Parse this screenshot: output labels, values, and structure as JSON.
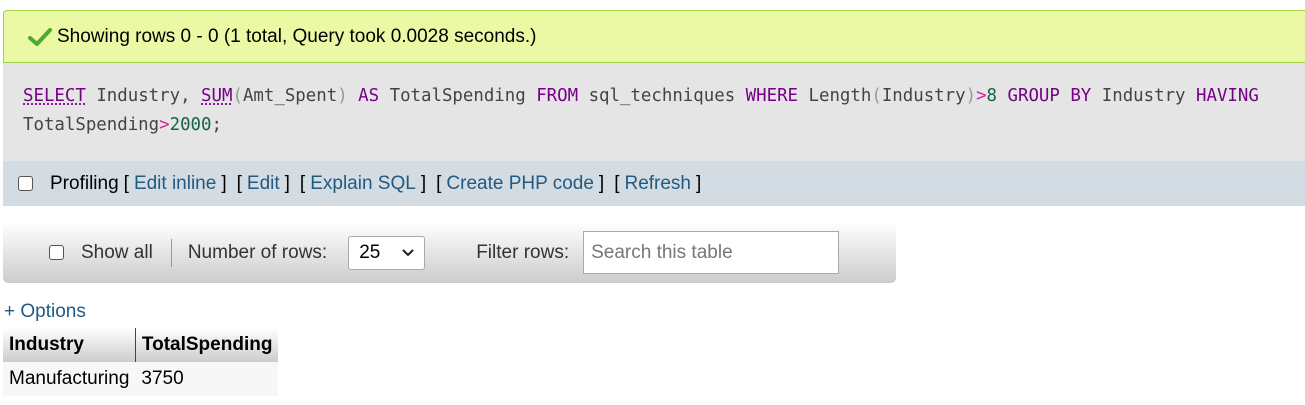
{
  "success": {
    "icon": "check-icon",
    "message": "Showing rows 0 - 0 (1 total, Query took 0.0028 seconds.)"
  },
  "sql": {
    "tokens": {
      "select": "SELECT",
      "industry": "Industry",
      "comma": ",",
      "sum": "SUM",
      "lparen": "(",
      "amt": "Amt_Spent",
      "rparen": ")",
      "as": "AS",
      "total": "TotalSpending",
      "from": "FROM",
      "table": "sql_techniques",
      "where": "WHERE",
      "length": "Length",
      "lparen2": "(",
      "industry2": "Industry",
      "rparen2": ")",
      "gt": ">",
      "eight": "8",
      "groupby": "GROUP BY",
      "industry3": "Industry",
      "having": "HAVING",
      "total2": "TotalSpending",
      "gt2": ">",
      "num2000": "2000",
      "semi": ";"
    }
  },
  "toolbar": {
    "profiling_label": "Profiling",
    "lb": "[",
    "rb": "]",
    "links": [
      "Edit inline",
      "Edit",
      "Explain SQL",
      "Create PHP code",
      "Refresh"
    ]
  },
  "nav": {
    "show_all_label": "Show all",
    "rows_label": "Number of rows:",
    "rows_value": "25",
    "filter_label": "Filter rows:",
    "search_placeholder": "Search this table"
  },
  "options_link": "+ Options",
  "table": {
    "columns": [
      "Industry",
      "TotalSpending"
    ],
    "rows": [
      [
        "Manufacturing",
        "3750"
      ]
    ]
  },
  "colors": {
    "success_bg": "#ebf8a4",
    "link": "#235a81",
    "keyword": "#770088",
    "number": "#116644"
  }
}
